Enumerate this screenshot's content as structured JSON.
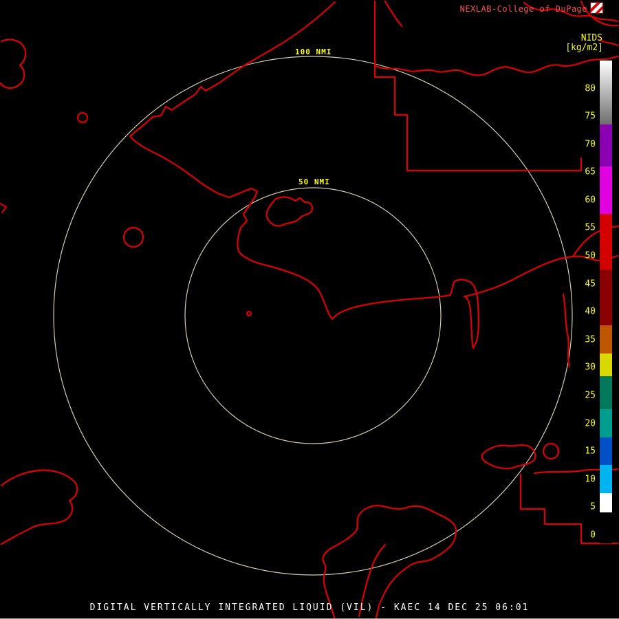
{
  "header": {
    "brand": "NEXLAB-College of DuPage"
  },
  "colorbar": {
    "product_label": "NIDS",
    "units_label": "[kg/m2]",
    "value_at_top": 85,
    "value_at_bottom": -1.5,
    "ticks": [
      80,
      75,
      70,
      65,
      60,
      55,
      50,
      45,
      40,
      35,
      30,
      25,
      20,
      15,
      10,
      5,
      0
    ],
    "segments": [
      {
        "from": 85,
        "to": 73.5,
        "color_top": "#ffffff",
        "color_bottom": "#6e6e6e"
      },
      {
        "from": 73.5,
        "to": 66,
        "color_top": "#8b00b0",
        "color_bottom": "#8b00b0"
      },
      {
        "from": 66,
        "to": 57.5,
        "color_top": "#e000e0",
        "color_bottom": "#e000e0"
      },
      {
        "from": 57.5,
        "to": 47.5,
        "color_top": "#d40000",
        "color_bottom": "#d40000"
      },
      {
        "from": 47.5,
        "to": 37.5,
        "color_top": "#8b0000",
        "color_bottom": "#8b0000"
      },
      {
        "from": 37.5,
        "to": 32.5,
        "color_top": "#bf5700",
        "color_bottom": "#bf5700"
      },
      {
        "from": 32.5,
        "to": 28.5,
        "color_top": "#d9d900",
        "color_bottom": "#d9d900"
      },
      {
        "from": 28.5,
        "to": 22.5,
        "color_top": "#00795c",
        "color_bottom": "#00795c"
      },
      {
        "from": 22.5,
        "to": 17.5,
        "color_top": "#009e90",
        "color_bottom": "#009e90"
      },
      {
        "from": 17.5,
        "to": 12.5,
        "color_top": "#0050c8",
        "color_bottom": "#0050c8"
      },
      {
        "from": 12.5,
        "to": 7.5,
        "color_top": "#00b4f0",
        "color_bottom": "#00b4f0"
      },
      {
        "from": 7.5,
        "to": 4,
        "color_top": "#ffffff",
        "color_bottom": "#ffffff"
      },
      {
        "from": 4,
        "to": -1.5,
        "color_top": "#000000",
        "color_bottom": "#000000"
      }
    ]
  },
  "map": {
    "range_ring_labels": [
      "100 NMI",
      "50 NMI"
    ],
    "outline_color": "#dd0000",
    "ring_color": "#d8ccaa"
  },
  "footer": {
    "title": "DIGITAL VERTICALLY INTEGRATED LIQUID (VIL) - KAEC 14 DEC 25 06:01"
  }
}
